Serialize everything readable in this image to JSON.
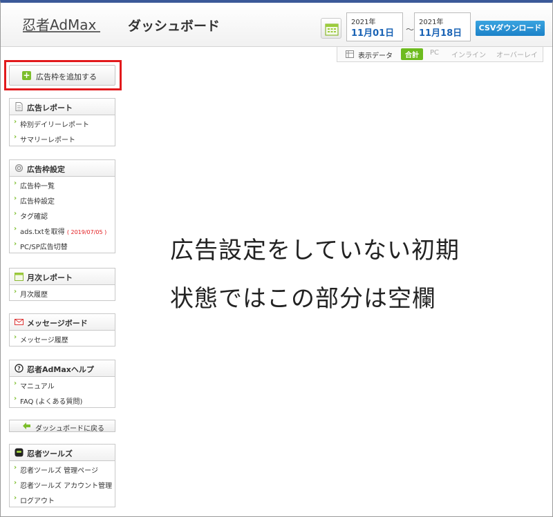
{
  "header": {
    "logo": "忍者AdMax",
    "title": "ダッシュボード",
    "start_year": "2021年",
    "start_date": "11月01日",
    "range_sep": "～",
    "end_year": "2021年",
    "end_date": "11月18日",
    "csv_label": "CSVダウンロード"
  },
  "display": {
    "label": "表示データ",
    "tabs": [
      "合計",
      "PC",
      "インライン",
      "オーバーレイ"
    ]
  },
  "sidebar": {
    "add_label": "広告枠を追加する",
    "report": {
      "title": "広告レポート",
      "items": [
        "枠別デイリーレポート",
        "サマリーレポート"
      ]
    },
    "settings": {
      "title": "広告枠設定",
      "items": [
        "広告枠一覧",
        "広告枠設定",
        "タグ確認",
        "ads.txtを取得",
        "PC/SP広告切替"
      ],
      "ads_date": "( 2019/07/05 )"
    },
    "monthly": {
      "title": "月次レポート",
      "items": [
        "月次履歴"
      ]
    },
    "message": {
      "title": "メッセージボード",
      "items": [
        "メッセージ履歴"
      ]
    },
    "help": {
      "title": "忍者AdMaxヘルプ",
      "items": [
        "マニュアル",
        "FAQ (よくある質問)"
      ]
    },
    "back_label": "ダッシュボードに戻る",
    "tools": {
      "title": "忍者ツールズ",
      "items": [
        "忍者ツールズ 管理ページ",
        "忍者ツールズ アカウント管理",
        "ログアウト"
      ]
    }
  },
  "main": {
    "note_line1": "広告設定をしていない初期",
    "note_line2": "状態ではこの部分は空欄"
  },
  "colors": {
    "accent_green": "#7cbe2b",
    "csv_blue": "#1c82c8",
    "highlight_red": "#e2191c"
  }
}
